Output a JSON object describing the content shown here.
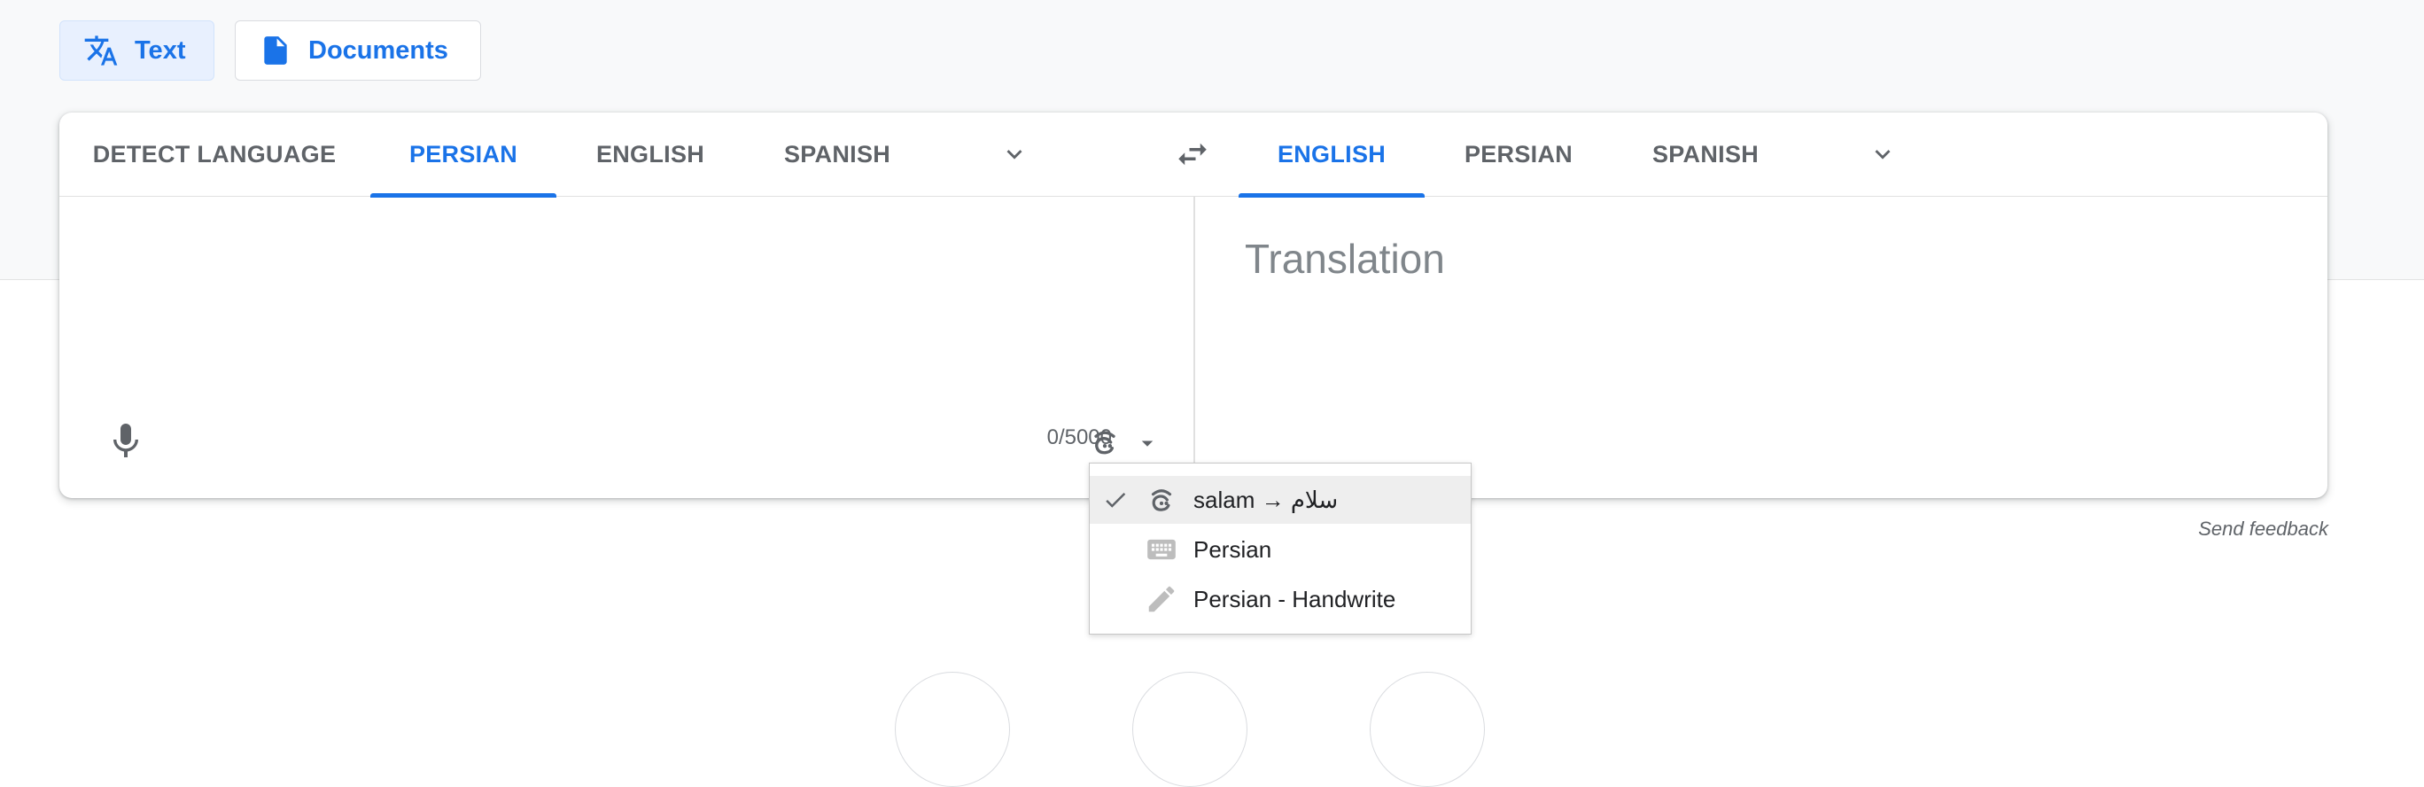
{
  "mode_tabs": [
    {
      "label": "Text",
      "icon": "translate-icon",
      "active": true
    },
    {
      "label": "Documents",
      "icon": "document-icon",
      "active": false
    }
  ],
  "source_languages": [
    "DETECT LANGUAGE",
    "PERSIAN",
    "ENGLISH",
    "SPANISH"
  ],
  "source_active": "PERSIAN",
  "target_languages": [
    "ENGLISH",
    "PERSIAN",
    "SPANISH"
  ],
  "target_active": "ENGLISH",
  "source": {
    "text": "",
    "char_count": "0/5000"
  },
  "target": {
    "placeholder": "Translation"
  },
  "input_tools_menu": {
    "items": [
      {
        "label": "salam → سلام",
        "icon": "transliteration-icon",
        "checked": true
      },
      {
        "label": "Persian",
        "icon": "keyboard-icon",
        "checked": false
      },
      {
        "label": "Persian - Handwrite",
        "icon": "pencil-icon",
        "checked": false
      }
    ]
  },
  "footer": {
    "send_feedback": "Send feedback"
  },
  "colors": {
    "accent": "#1a73e8",
    "active_tab_bg": "#e8f0fe",
    "muted_text": "#5f6368",
    "band_bg": "#f8f9fa"
  }
}
